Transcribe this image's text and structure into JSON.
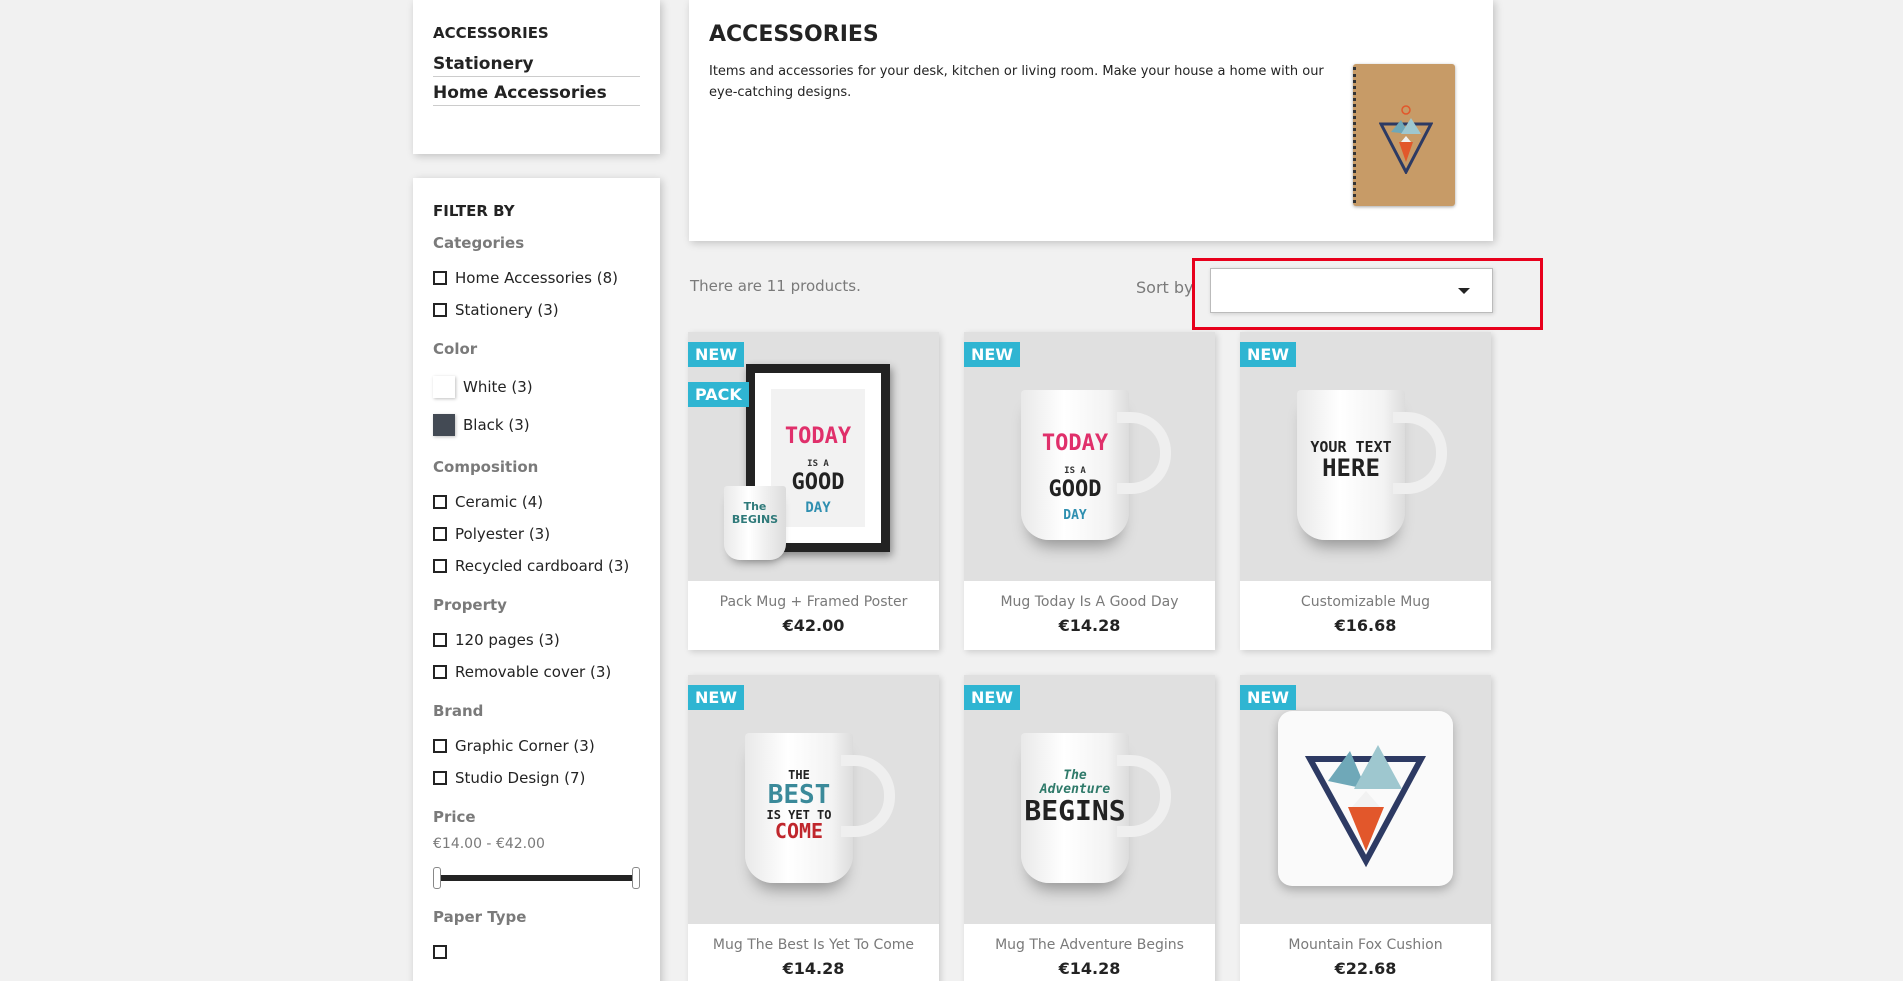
{
  "sidebar": {
    "category_title": "ACCESSORIES",
    "subcategories": [
      "Stationery",
      "Home Accessories"
    ]
  },
  "filters": {
    "title": "FILTER BY",
    "categories": {
      "title": "Categories",
      "options": [
        "Home Accessories (8)",
        "Stationery (3)"
      ]
    },
    "color": {
      "title": "Color",
      "options": [
        {
          "label": "White (3)",
          "color": "#ffffff"
        },
        {
          "label": "Black (3)",
          "color": "#434a54"
        }
      ]
    },
    "composition": {
      "title": "Composition",
      "options": [
        "Ceramic (4)",
        "Polyester (3)",
        "Recycled cardboard (3)"
      ]
    },
    "property": {
      "title": "Property",
      "options": [
        "120 pages (3)",
        "Removable cover (3)"
      ]
    },
    "brand": {
      "title": "Brand",
      "options": [
        "Graphic Corner (3)",
        "Studio Design (7)"
      ]
    },
    "price": {
      "title": "Price",
      "range": "€14.00 - €42.00",
      "min_selected": 14,
      "max_selected": 42
    },
    "paper_type": {
      "title": "Paper Type"
    }
  },
  "header": {
    "title": "ACCESSORIES",
    "description": "Items and accessories for your desk, kitchen or living room. Make your house a home with our eye-catching designs."
  },
  "listing": {
    "count_text": "There are 11 products.",
    "sort_label": "Sort by",
    "sort_value": ""
  },
  "products": [
    {
      "name": "Pack Mug + Framed Poster",
      "price": "€42.00",
      "flags": [
        "NEW",
        "PACK"
      ]
    },
    {
      "name": "Mug Today Is A Good Day",
      "price": "€14.28",
      "flags": [
        "NEW"
      ]
    },
    {
      "name": "Customizable Mug",
      "price": "€16.68",
      "flags": [
        "NEW"
      ]
    },
    {
      "name": "Mug The Best Is Yet To Come",
      "price": "€14.28",
      "flags": [
        "NEW"
      ]
    },
    {
      "name": "Mug The Adventure Begins",
      "price": "€14.28",
      "flags": [
        "NEW"
      ]
    },
    {
      "name": "Mountain Fox Cushion",
      "price": "€22.68",
      "flags": [
        "NEW"
      ]
    }
  ],
  "colors": {
    "accent": "#2fb5d2",
    "highlight": "#e8001c"
  }
}
